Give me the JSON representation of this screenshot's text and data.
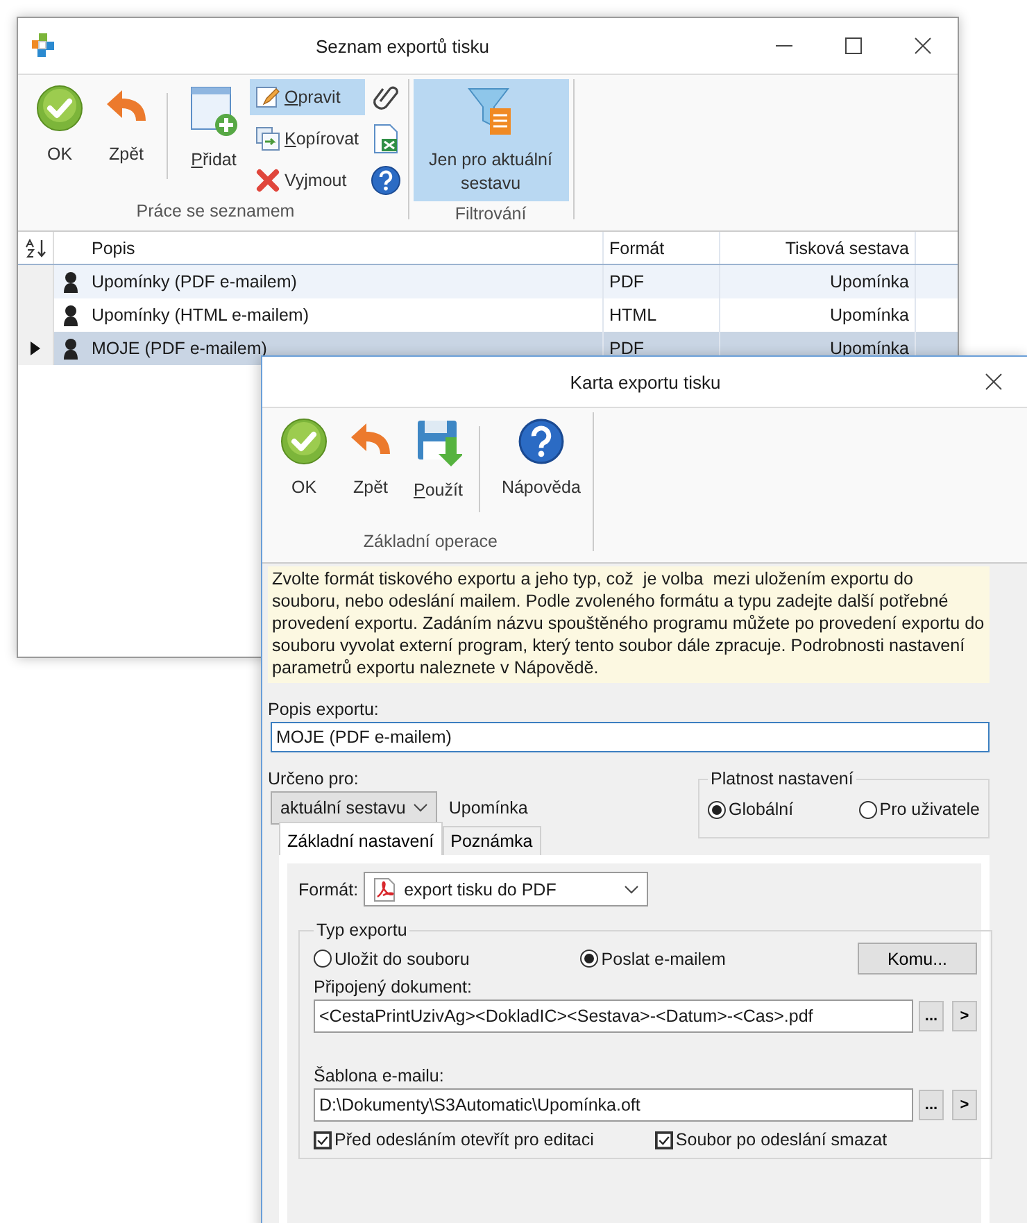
{
  "main_window": {
    "title": "Seznam exportů tisku",
    "ribbon": [
      {
        "label": "Práce se seznamem",
        "buttons": [
          {
            "kind": "large",
            "label": "OK",
            "mnemonic": false,
            "pressed": false,
            "separated": false
          },
          {
            "kind": "large",
            "label": "Zpět",
            "mnemonic": false,
            "pressed": false,
            "separated": false
          },
          {
            "kind": "large",
            "label": "Přidat",
            "mnemonic": true,
            "pressed": false,
            "separated": true
          },
          {
            "kind": "small",
            "label": "Opravit",
            "mnemonic": true,
            "pressed": true,
            "separated": false
          },
          {
            "kind": "small",
            "label": "Kopírovat",
            "mnemonic": true,
            "pressed": false,
            "separated": false
          },
          {
            "kind": "small",
            "label": "Vyjmout",
            "mnemonic": false,
            "pressed": false,
            "separated": false
          },
          {
            "kind": "icon",
            "pressed": false,
            "separated": false
          },
          {
            "kind": "icon",
            "pressed": false,
            "separated": false
          },
          {
            "kind": "icon",
            "pressed": false,
            "separated": false
          }
        ]
      },
      {
        "label": "Filtrování",
        "buttons": [
          {
            "kind": "large",
            "label": "Jen pro aktuální sestavu",
            "mnemonic": false,
            "pressed": true,
            "separated": false
          }
        ]
      }
    ],
    "table": {
      "columns": [
        "Popis",
        "Formát",
        "Tisková sestava"
      ],
      "rows": [
        {
          "popis": "Upomínky (PDF e-mailem)",
          "format": "PDF",
          "sestava": "Upomínka",
          "selected": false
        },
        {
          "popis": "Upomínky (HTML e-mailem)",
          "format": "HTML",
          "sestava": "Upomínka",
          "selected": false
        },
        {
          "popis": "MOJE (PDF e-mailem)",
          "format": "PDF",
          "sestava": "Upomínka",
          "selected": true
        }
      ]
    }
  },
  "dialog": {
    "title": "Karta exportu tisku",
    "ribbon": [
      {
        "label": "Základní operace",
        "buttons": [
          {
            "kind": "large",
            "label": "OK",
            "mnemonic": false,
            "pressed": false,
            "separated": false
          },
          {
            "kind": "large",
            "label": "Zpět",
            "mnemonic": false,
            "pressed": false,
            "separated": false
          },
          {
            "kind": "large",
            "label": "Použít",
            "mnemonic": true,
            "pressed": false,
            "separated": false
          },
          {
            "kind": "large",
            "label": "Nápověda",
            "mnemonic": false,
            "pressed": false,
            "separated": true
          }
        ]
      }
    ],
    "info": "Zvolte formát tiskového exportu a jeho typ, což  je volba  mezi uložením exportu do souboru, nebo odeslání mailem. Podle zvoleného formátu a typu zadejte další potřebné provedení exportu. Zadáním názvu spouštěného programu můžete po provedení exportu do souboru vyvolat externí program, který tento soubor dále zpracuje. Podrobnosti nastavení parametrů exportu naleznete v Nápovědě.",
    "description": {
      "label": "Popis exportu:",
      "value": "MOJE (PDF e-mailem)"
    },
    "intended_for": {
      "label": "Určeno pro:",
      "value": "aktuální sestavu",
      "report": "Upomínka"
    },
    "validity": {
      "legend": "Platnost nastavení",
      "options": [
        {
          "label": "Globální",
          "selected": true
        },
        {
          "label": "Pro uživatele",
          "selected": false
        }
      ]
    },
    "tabs": [
      {
        "label": "Základní nastavení",
        "selected": true
      },
      {
        "label": "Poznámka",
        "selected": false
      }
    ],
    "format": {
      "label": "Formát:",
      "value": "export tisku do PDF"
    },
    "export_type": {
      "legend": "Typ exportu",
      "options": [
        {
          "label": "Uložit do souboru",
          "selected": false
        },
        {
          "label": "Poslat e-mailem",
          "selected": true
        }
      ],
      "recipients_button": "Komu...",
      "fields": [
        {
          "label": "Připojený dokument:",
          "value": "<CestaPrintUzivAg><DokladIC><Sestava>-<Datum>-<Cas>.pdf",
          "browse": "...",
          "open": ">"
        },
        {
          "label": "Šablona e-mailu:",
          "value": "D:\\Dokumenty\\S3Automatic\\Upomínka.oft",
          "browse": "...",
          "open": ">"
        }
      ],
      "checkboxes": [
        {
          "label": "Před odesláním otevřít pro editaci",
          "checked": true
        },
        {
          "label": "Soubor po odeslání smazat",
          "checked": true
        }
      ]
    }
  }
}
